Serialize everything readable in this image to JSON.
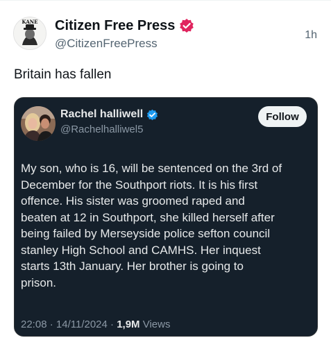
{
  "post": {
    "author": {
      "display_name": "Citizen Free Press",
      "handle": "@CitizenFreePress",
      "verified": true,
      "avatar_text": "KANE",
      "badge_color": "#e0245e"
    },
    "timestamp": "1h",
    "text": "Britain has fallen"
  },
  "quoted": {
    "author": {
      "display_name": "Rachel halliwell",
      "handle": "@Rachelhalliwel5",
      "verified": true,
      "badge_color": "#1d9bf0"
    },
    "follow_label": "Follow",
    "lines": [
      "My son, who is 16, will be sentenced on the 3rd of",
      "December for the Southport riots. It is his first",
      "offence.  His sister was groomed raped and",
      "beaten at 12 in Southport, she killed herself after",
      "being failed by Merseyside police sefton council",
      "stanley High School and CAMHS.  Her inquest",
      "starts 13th January.  Her brother is going to",
      "prison."
    ],
    "time": "22:08",
    "date": "14/11/2024",
    "separator": "·",
    "views_count": "1,9M",
    "views_label": "Views"
  }
}
